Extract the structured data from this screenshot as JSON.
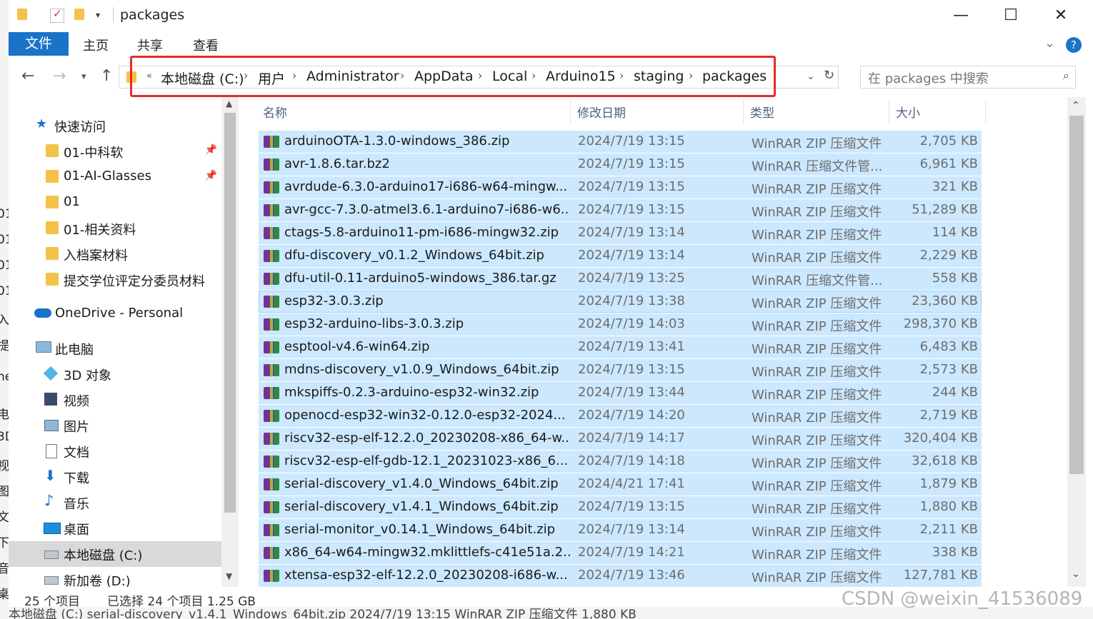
{
  "window": {
    "title": "packages",
    "minimize_glyph": "—",
    "maximize_glyph": "☐",
    "close_glyph": "✕"
  },
  "ribbon": {
    "tabs": [
      "文件",
      "主页",
      "共享",
      "查看"
    ]
  },
  "address": {
    "prefix": "«",
    "crumbs": [
      "本地磁盘 (C:)",
      "用户",
      "Administrator",
      "AppData",
      "Local",
      "Arduino15",
      "staging",
      "packages"
    ],
    "search_placeholder": "在 packages 中搜索"
  },
  "nav": {
    "quick_access": "快速访问",
    "items": [
      {
        "label": "01-中科软",
        "pinned": true
      },
      {
        "label": "01-AI-Glasses",
        "pinned": true
      },
      {
        "label": "01",
        "pinned": false
      },
      {
        "label": "01-相关资料",
        "pinned": false
      },
      {
        "label": "入档案材料",
        "pinned": false
      },
      {
        "label": "提交学位评定分委员材料",
        "pinned": false
      }
    ],
    "onedrive": "OneDrive - Personal",
    "this_pc": "此电脑",
    "pc_items": [
      "3D 对象",
      "视频",
      "图片",
      "文档",
      "下载",
      "音乐",
      "桌面",
      "本地磁盘 (C:)",
      "新加卷 (D:)"
    ]
  },
  "columns": {
    "name": "名称",
    "date": "修改日期",
    "type": "类型",
    "size": "大小"
  },
  "files": [
    {
      "name": "arduinoOTA-1.3.0-windows_386.zip",
      "date": "2024/7/19 13:15",
      "type": "WinRAR ZIP 压缩文件",
      "size": "2,705 KB"
    },
    {
      "name": "avr-1.8.6.tar.bz2",
      "date": "2024/7/19 13:15",
      "type": "WinRAR 压缩文件管...",
      "size": "6,961 KB"
    },
    {
      "name": "avrdude-6.3.0-arduino17-i686-w64-mingw...",
      "date": "2024/7/19 13:15",
      "type": "WinRAR ZIP 压缩文件",
      "size": "321 KB"
    },
    {
      "name": "avr-gcc-7.3.0-atmel3.6.1-arduino7-i686-w6...",
      "date": "2024/7/19 13:15",
      "type": "WinRAR ZIP 压缩文件",
      "size": "51,289 KB"
    },
    {
      "name": "ctags-5.8-arduino11-pm-i686-mingw32.zip",
      "date": "2024/7/19 13:14",
      "type": "WinRAR ZIP 压缩文件",
      "size": "114 KB"
    },
    {
      "name": "dfu-discovery_v0.1.2_Windows_64bit.zip",
      "date": "2024/7/19 13:14",
      "type": "WinRAR ZIP 压缩文件",
      "size": "2,229 KB"
    },
    {
      "name": "dfu-util-0.11-arduino5-windows_386.tar.gz",
      "date": "2024/7/19 13:25",
      "type": "WinRAR 压缩文件管...",
      "size": "558 KB"
    },
    {
      "name": "esp32-3.0.3.zip",
      "date": "2024/7/19 13:38",
      "type": "WinRAR ZIP 压缩文件",
      "size": "23,360 KB"
    },
    {
      "name": "esp32-arduino-libs-3.0.3.zip",
      "date": "2024/7/19 14:03",
      "type": "WinRAR ZIP 压缩文件",
      "size": "298,370 KB"
    },
    {
      "name": "esptool-v4.6-win64.zip",
      "date": "2024/7/19 13:41",
      "type": "WinRAR ZIP 压缩文件",
      "size": "6,483 KB"
    },
    {
      "name": "mdns-discovery_v1.0.9_Windows_64bit.zip",
      "date": "2024/7/19 13:15",
      "type": "WinRAR ZIP 压缩文件",
      "size": "2,573 KB"
    },
    {
      "name": "mkspiffs-0.2.3-arduino-esp32-win32.zip",
      "date": "2024/7/19 13:44",
      "type": "WinRAR ZIP 压缩文件",
      "size": "244 KB"
    },
    {
      "name": "openocd-esp32-win32-0.12.0-esp32-2024...",
      "date": "2024/7/19 14:20",
      "type": "WinRAR ZIP 压缩文件",
      "size": "2,719 KB"
    },
    {
      "name": "riscv32-esp-elf-12.2.0_20230208-x86_64-w...",
      "date": "2024/7/19 14:17",
      "type": "WinRAR ZIP 压缩文件",
      "size": "320,404 KB"
    },
    {
      "name": "riscv32-esp-elf-gdb-12.1_20231023-x86_6...",
      "date": "2024/7/19 14:18",
      "type": "WinRAR ZIP 压缩文件",
      "size": "32,618 KB"
    },
    {
      "name": "serial-discovery_v1.4.0_Windows_64bit.zip",
      "date": "2024/4/21 17:41",
      "type": "WinRAR ZIP 压缩文件",
      "size": "1,879 KB"
    },
    {
      "name": "serial-discovery_v1.4.1_Windows_64bit.zip",
      "date": "2024/7/19 13:15",
      "type": "WinRAR ZIP 压缩文件",
      "size": "1,880 KB"
    },
    {
      "name": "serial-monitor_v0.14.1_Windows_64bit.zip",
      "date": "2024/7/19 13:14",
      "type": "WinRAR ZIP 压缩文件",
      "size": "2,211 KB"
    },
    {
      "name": "x86_64-w64-mingw32.mklittlefs-c41e51a.2...",
      "date": "2024/7/19 14:21",
      "type": "WinRAR ZIP 压缩文件",
      "size": "338 KB"
    },
    {
      "name": "xtensa-esp32-elf-12.2.0_20230208-i686-w...",
      "date": "2024/7/19 13:46",
      "type": "WinRAR ZIP 压缩文件",
      "size": "127,781 KB"
    }
  ],
  "status": {
    "count": "25 个项目",
    "selected": "已选择 24 个项目  1.25 GB"
  },
  "background_window": {
    "bottom_text": "本地磁盘 (C:)        serial-discovery_v1.4.1_Windows_64bit.zip                    2024/7/19 13:15                  WinRAR ZIP 压缩文件              1,880 KB"
  },
  "watermark": "CSDN @weixin_41536089",
  "colors": {
    "accent": "#1a73c7",
    "selection": "#cce8ff",
    "highlight_box": "#e52b2b"
  }
}
